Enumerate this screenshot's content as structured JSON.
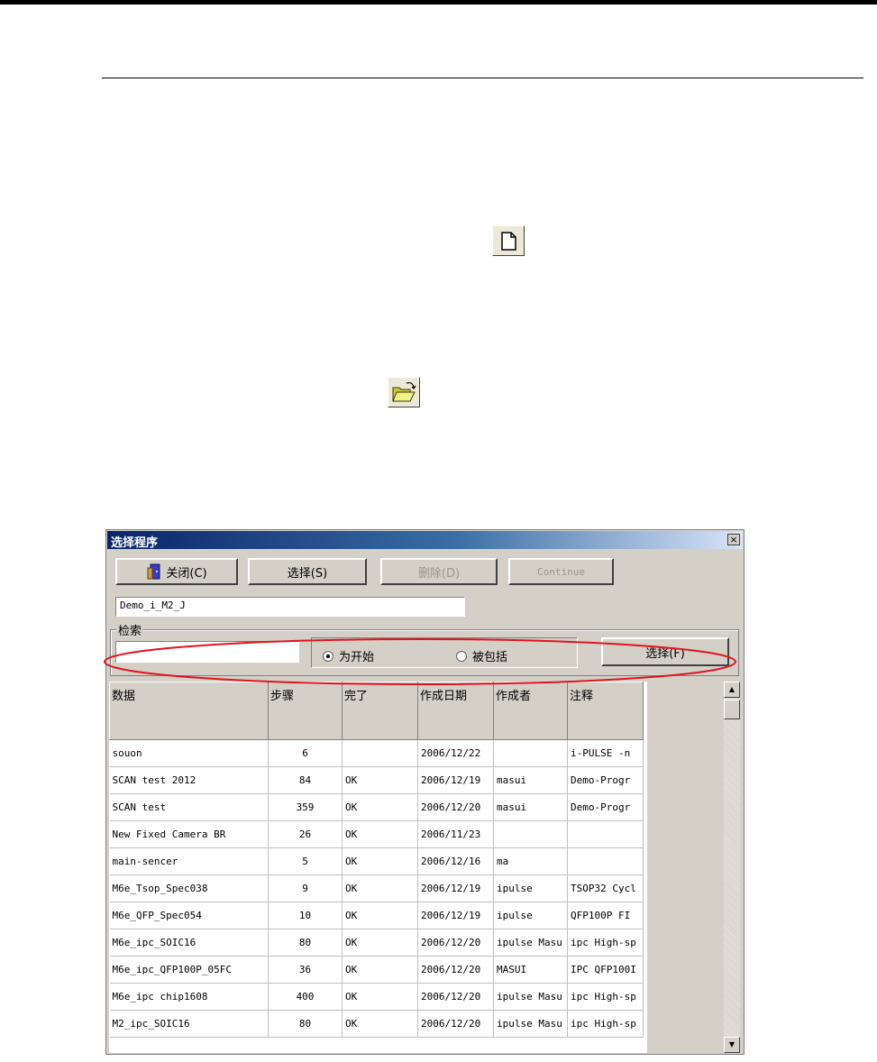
{
  "dialog": {
    "title": "选择程序",
    "close_glyph": "×",
    "buttons": {
      "close_label": "关闭(C)",
      "select_label": "选择(S)",
      "delete_label": "删除(D)",
      "continue_label": "Continue"
    },
    "program_name_value": "Demo_i_M2_J",
    "search": {
      "group_label": "检索",
      "input_value": "",
      "radio_start_label": "为开始",
      "radio_contains_label": "被包括",
      "radio_selected": "start",
      "find_button_label": "选择(F)"
    },
    "table": {
      "columns": [
        "数据",
        "步骤",
        "完了",
        "作成日期",
        "作成者",
        "注释"
      ],
      "rows": [
        [
          "souon",
          "6",
          "",
          "2006/12/22",
          "",
          "i-PULSE -n"
        ],
        [
          "SCAN test 2012",
          "84",
          "OK",
          "2006/12/19",
          "masui",
          "Demo-Progr"
        ],
        [
          "SCAN test",
          "359",
          "OK",
          "2006/12/20",
          "masui",
          "Demo-Progr"
        ],
        [
          "New Fixed Camera BR",
          "26",
          "OK",
          "2006/11/23",
          "",
          ""
        ],
        [
          "main-sencer",
          "5",
          "OK",
          "2006/12/16",
          "ma",
          ""
        ],
        [
          "M6e_Tsop_Spec038",
          "9",
          "OK",
          "2006/12/19",
          "ipulse",
          "TSOP32 Cycl"
        ],
        [
          "M6e_QFP_Spec054",
          "10",
          "OK",
          "2006/12/19",
          "ipulse",
          "QFP100P FI"
        ],
        [
          "M6e_ipc_SOIC16",
          "80",
          "OK",
          "2006/12/20",
          "ipulse Masu",
          "ipc High-sp"
        ],
        [
          "M6e_ipc_QFP100P_05FC",
          "36",
          "OK",
          "2006/12/20",
          "MASUI",
          "IPC QFP100I"
        ],
        [
          "M6e_ipc chip1608",
          "400",
          "OK",
          "2006/12/20",
          "ipulse Masu",
          "ipc High-sp"
        ],
        [
          "M2_ipc_SOIC16",
          "80",
          "OK",
          "2006/12/20",
          "ipulse Masu",
          "ipc High-sp"
        ]
      ]
    },
    "scroll_up_glyph": "▲",
    "scroll_down_glyph": "▼"
  },
  "icons": {
    "new_document": "new-document-icon",
    "open_folder": "open-folder-icon",
    "exit": "exit-door-icon"
  },
  "colors": {
    "annotation_oval": "#e0141e",
    "titlebar_start": "#0a246a",
    "titlebar_end": "#d8e4f8"
  }
}
